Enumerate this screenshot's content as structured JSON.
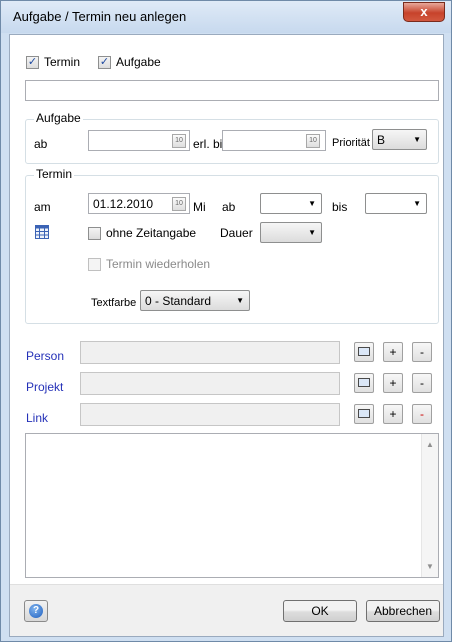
{
  "window": {
    "title": "Aufgabe / Termin  neu anlegen",
    "close_glyph": "x"
  },
  "top": {
    "termin_label": "Termin",
    "termin_checked": true,
    "aufgabe_label": "Aufgabe",
    "aufgabe_checked": true,
    "subject_value": ""
  },
  "aufgabe_group": {
    "title": "Aufgabe",
    "ab_label": "ab",
    "ab_value": "",
    "erl_bis_label": "erl. bis",
    "erl_bis_value": "",
    "prioritaet_label": "Priorität",
    "prioritaet_value": "B"
  },
  "termin_group": {
    "title": "Termin",
    "am_label": "am",
    "am_value": "01.12.2010",
    "weekday": "Mi",
    "ab_label": "ab",
    "ab_value": "",
    "bis_label": "bis",
    "bis_value": "",
    "ohne_zeitangabe_label": "ohne Zeitangabe",
    "ohne_zeitangabe_checked": false,
    "dauer_label": "Dauer",
    "dauer_value": "",
    "wiederholen_label": "Termin wiederholen",
    "wiederholen_checked": false,
    "textfarbe_label": "Textfarbe",
    "textfarbe_value": "0 - Standard"
  },
  "links": {
    "person_label": "Person",
    "person_value": "",
    "projekt_label": "Projekt",
    "projekt_value": "",
    "link_label": "Link",
    "link_value": "",
    "add_glyph": "+",
    "remove_glyph": "-"
  },
  "notes": {
    "value": ""
  },
  "footer": {
    "ok_label": "OK",
    "cancel_label": "Abbrechen",
    "help_glyph": "?"
  },
  "icons": {
    "checkbox_checked": "checkmark-icon",
    "calendar_button": "calendar-icon",
    "calendar_grid": "calendar-grid-icon",
    "lookup": "card-lookup-icon",
    "dropdown": "chevron-down-icon",
    "help": "help-icon",
    "close": "close-icon"
  },
  "colors": {
    "link_label": "#2531b8",
    "close_button": "#c7432b",
    "window_frame": "#cfdff1"
  }
}
